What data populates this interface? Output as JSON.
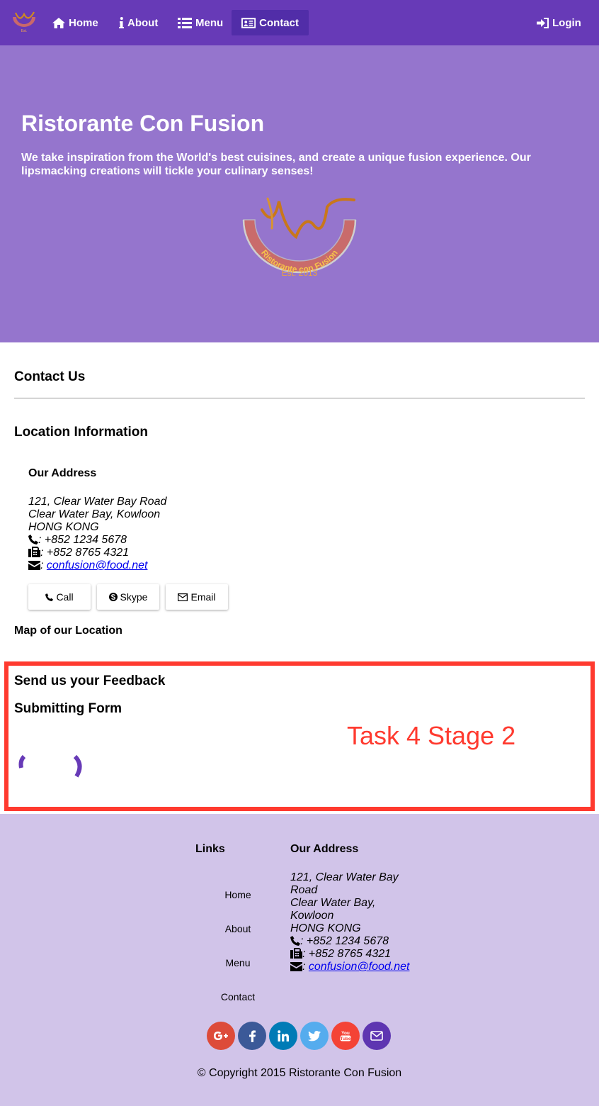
{
  "toolbar": {
    "nav": [
      {
        "label": "Home",
        "icon": "home-icon"
      },
      {
        "label": "About",
        "icon": "info-icon"
      },
      {
        "label": "Menu",
        "icon": "list-icon"
      },
      {
        "label": "Contact",
        "icon": "address-card-icon",
        "active": true
      }
    ],
    "login_label": "Login"
  },
  "jumbotron": {
    "title": "Ristorante Con Fusion",
    "description": "We take inspiration from the World's best cuisines, and create a unique fusion experience. Our lipsmacking creations will tickle your culinary senses!",
    "logo_text": "Ristorante con Fusion",
    "logo_est": "Est. 2013"
  },
  "contact": {
    "heading": "Contact Us",
    "location_heading": "Location Information",
    "address_heading": "Our Address",
    "address_lines": [
      "121, Clear Water Bay Road",
      "Clear Water Bay, Kowloon",
      "HONG KONG"
    ],
    "phone": ": +852 1234 5678",
    "fax": ": +852 8765 4321",
    "email_prefix": ": ",
    "email": "confusion@food.net",
    "buttons": {
      "call": "Call",
      "skype": "Skype",
      "email": "Email"
    },
    "map_heading": "Map of our Location"
  },
  "feedback": {
    "heading": "Send us your Feedback",
    "submitting": "Submitting Form",
    "annotation": "Task 4 Stage 2"
  },
  "footer": {
    "links_heading": "Links",
    "links": [
      "Home",
      "About",
      "Menu",
      "Contact"
    ],
    "address_heading": "Our Address",
    "address_lines": [
      "121, Clear Water Bay",
      "Road",
      "Clear Water Bay,",
      "Kowloon",
      "HONG KONG"
    ],
    "phone": ": +852 1234 5678",
    "fax": ": +852 8765 4321",
    "email_prefix": ": ",
    "email": "confusion@food.net",
    "socials": [
      {
        "name": "google-plus-icon",
        "color": "#dd4b39"
      },
      {
        "name": "facebook-icon",
        "color": "#3b5998"
      },
      {
        "name": "linkedin-icon",
        "color": "#007bb6"
      },
      {
        "name": "twitter-icon",
        "color": "#55acee"
      },
      {
        "name": "youtube-icon",
        "color": "#f44336"
      },
      {
        "name": "mail-icon",
        "color": "#5e35b1"
      }
    ],
    "copyright": "© Copyright 2015 Ristorante Con Fusion"
  },
  "colors": {
    "primary": "#673ab7",
    "primary_dark": "#512da8",
    "primary_light": "#9575cd",
    "footer_bg": "#d1c4e9",
    "annotation": "#ff3a2f"
  }
}
